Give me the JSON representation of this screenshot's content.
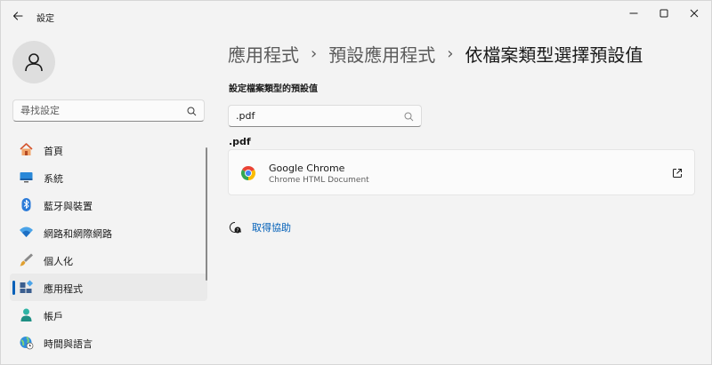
{
  "titlebar": {
    "app_title": "設定",
    "back_icon": "arrow-left-icon",
    "minimize_icon": "minimize-icon",
    "maximize_icon": "maximize-icon",
    "close_icon": "close-icon"
  },
  "sidebar": {
    "search_placeholder": "尋找設定",
    "search_icon": "search-icon",
    "items": [
      {
        "label": "首頁",
        "icon": "home-icon",
        "active": false
      },
      {
        "label": "系統",
        "icon": "monitor-icon",
        "active": false
      },
      {
        "label": "藍牙與裝置",
        "icon": "bluetooth-icon",
        "active": false
      },
      {
        "label": "網路和網際網路",
        "icon": "wifi-icon",
        "active": false
      },
      {
        "label": "個人化",
        "icon": "brush-icon",
        "active": false
      },
      {
        "label": "應用程式",
        "icon": "apps-icon",
        "active": true
      },
      {
        "label": "帳戶",
        "icon": "user-icon",
        "active": false
      },
      {
        "label": "時間與語言",
        "icon": "globe-clock-icon",
        "active": false
      }
    ]
  },
  "breadcrumb": {
    "items": [
      "應用程式",
      "預設應用程式",
      "依檔案類型選擇預設值"
    ],
    "separator": "›"
  },
  "main": {
    "section_title": "設定檔案類型的預設值",
    "ext_input_value": ".pdf",
    "ext_heading": ".pdf",
    "app_card": {
      "name": "Google Chrome",
      "description": "Chrome HTML Document",
      "icon": "chrome-logo-icon",
      "action_icon": "open-external-icon"
    },
    "help_label": "取得協助",
    "help_icon": "help-chat-icon"
  },
  "colors": {
    "accent": "#005fb8",
    "window_bg": "#f3f3f3",
    "card_bg": "#fbfbfb"
  }
}
